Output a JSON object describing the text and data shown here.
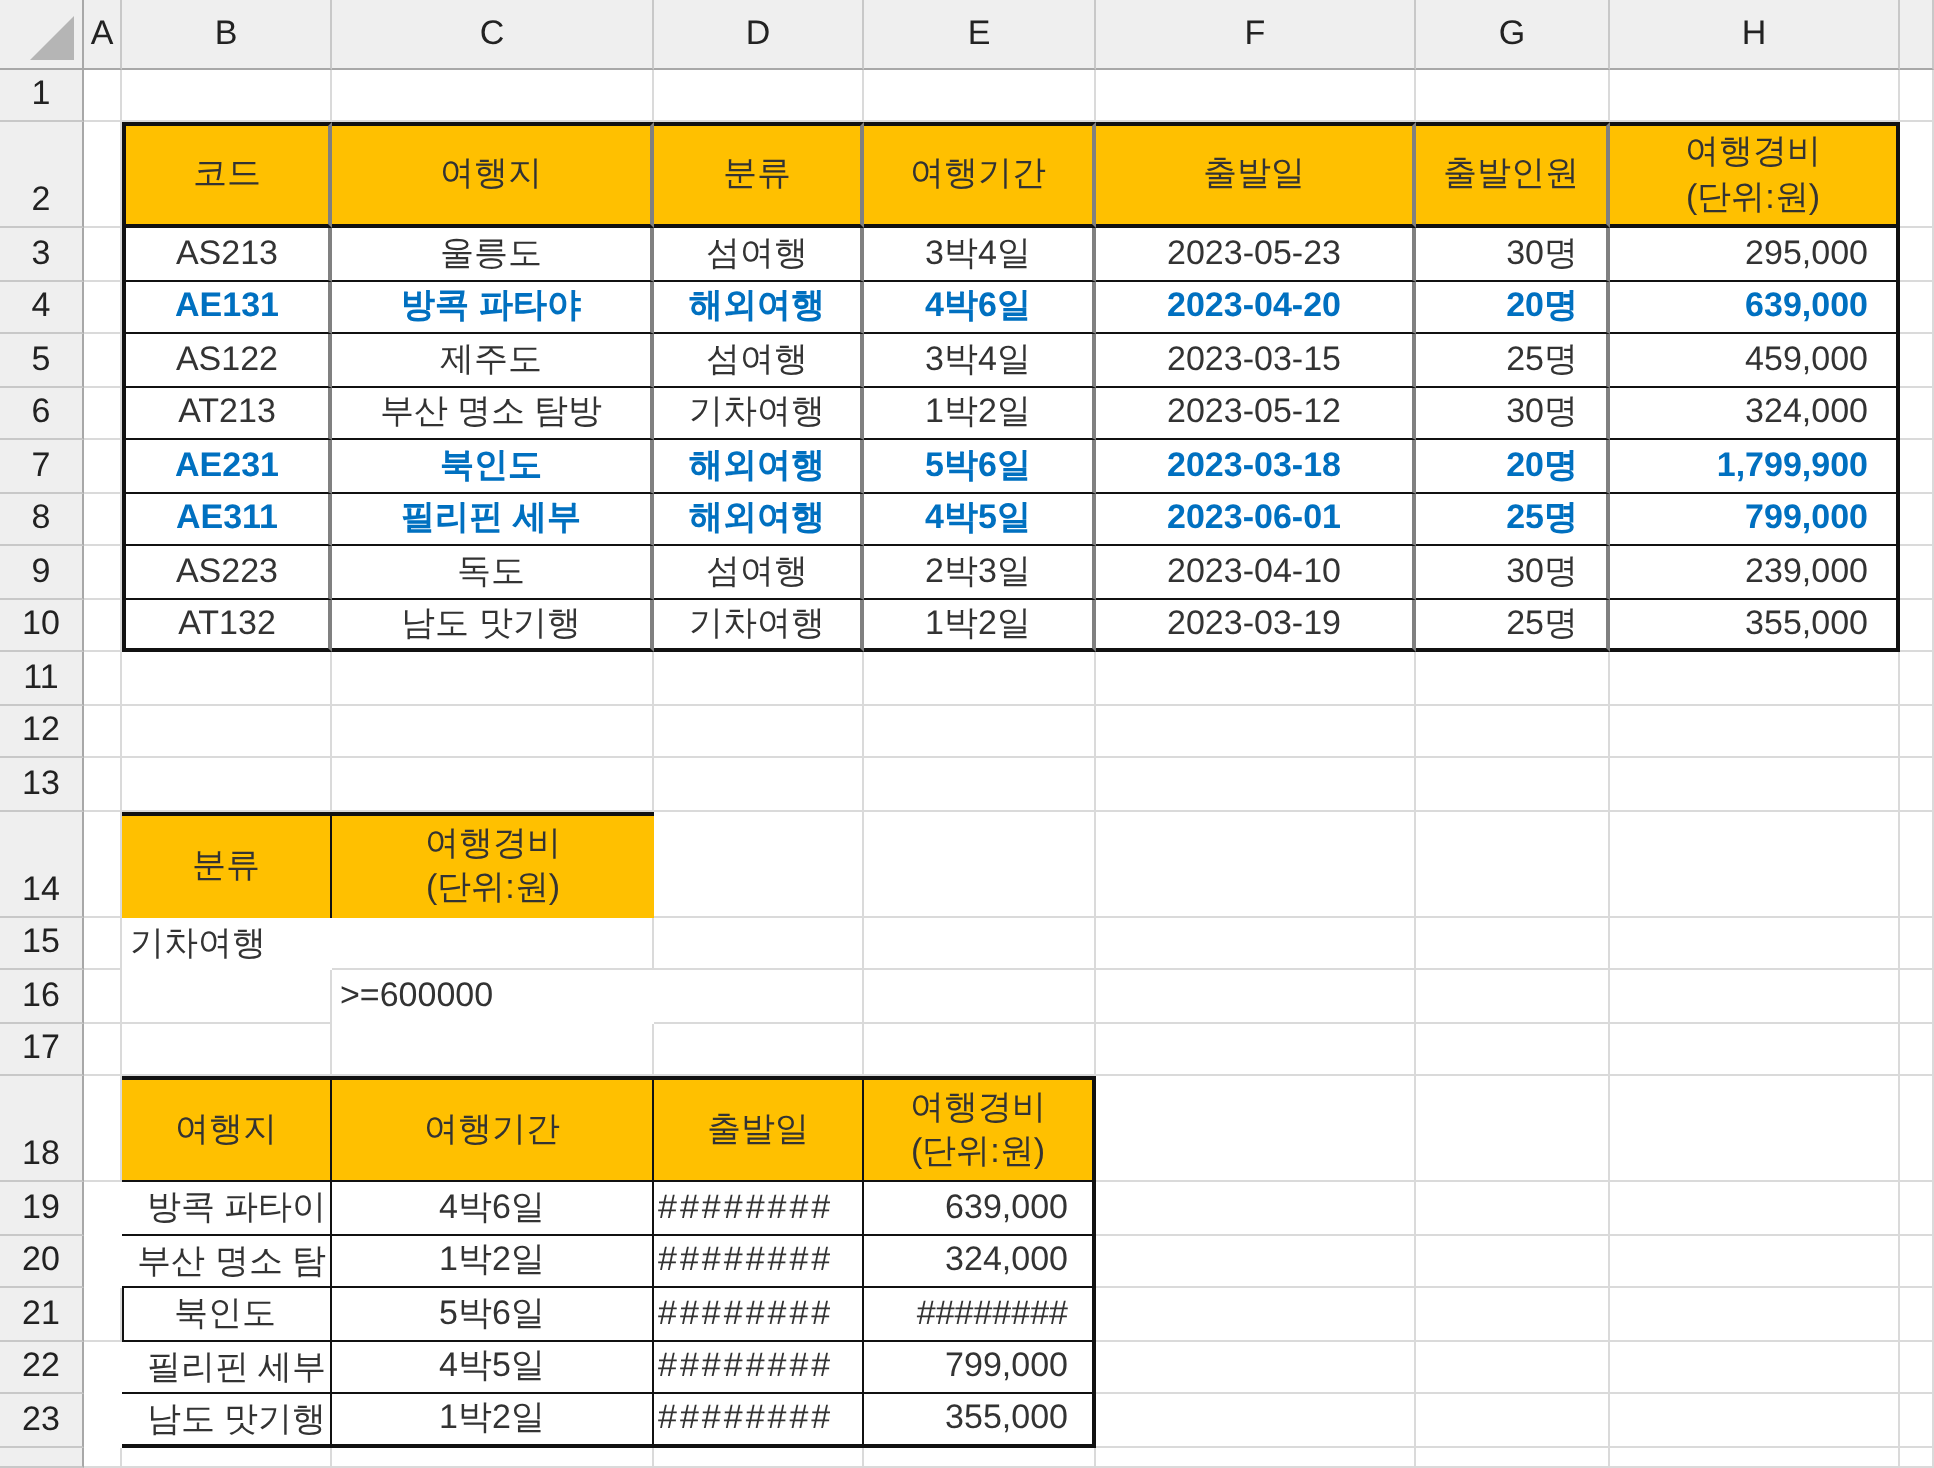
{
  "columns": [
    "A",
    "B",
    "C",
    "D",
    "E",
    "F",
    "G",
    "H"
  ],
  "rows": [
    "1",
    "2",
    "3",
    "4",
    "5",
    "6",
    "7",
    "8",
    "9",
    "10",
    "11",
    "12",
    "13",
    "14",
    "15",
    "16",
    "17",
    "18",
    "19",
    "20",
    "21",
    "22",
    "23"
  ],
  "trips": {
    "headers": [
      {
        "text": "코드",
        "kind": "text"
      },
      {
        "text": "여행지",
        "kind": "text"
      },
      {
        "text": "분류",
        "kind": "text"
      },
      {
        "text": "여행기간",
        "kind": "text"
      },
      {
        "text": "출발일",
        "kind": "text"
      },
      {
        "text": "출발인원",
        "kind": "number"
      },
      {
        "text": "여행경비\n(단위:원)",
        "kind": "number"
      }
    ],
    "rows": [
      {
        "highlighted": false,
        "cells": [
          "AS213",
          "울릉도",
          "섬여행",
          "3박4일",
          "2023-05-23",
          "30명",
          "295,000"
        ]
      },
      {
        "highlighted": true,
        "cells": [
          "AE131",
          "방콕 파타야",
          "해외여행",
          "4박6일",
          "2023-04-20",
          "20명",
          "639,000"
        ]
      },
      {
        "highlighted": false,
        "cells": [
          "AS122",
          "제주도",
          "섬여행",
          "3박4일",
          "2023-03-15",
          "25명",
          "459,000"
        ]
      },
      {
        "highlighted": false,
        "cells": [
          "AT213",
          "부산 명소 탐방",
          "기차여행",
          "1박2일",
          "2023-05-12",
          "30명",
          "324,000"
        ]
      },
      {
        "highlighted": true,
        "cells": [
          "AE231",
          "북인도",
          "해외여행",
          "5박6일",
          "2023-03-18",
          "20명",
          "1,799,900"
        ]
      },
      {
        "highlighted": true,
        "cells": [
          "AE311",
          "필리핀 세부",
          "해외여행",
          "4박5일",
          "2023-06-01",
          "25명",
          "799,000"
        ]
      },
      {
        "highlighted": false,
        "cells": [
          "AS223",
          "독도",
          "섬여행",
          "2박3일",
          "2023-04-10",
          "30명",
          "239,000"
        ]
      },
      {
        "highlighted": false,
        "cells": [
          "AT132",
          "남도 맛기행",
          "기차여행",
          "1박2일",
          "2023-03-19",
          "25명",
          "355,000"
        ]
      }
    ]
  },
  "criteria": {
    "headers": [
      "분류",
      "여행경비\n(단위:원)"
    ],
    "rows": [
      {
        "kind": "category",
        "text": "기차여행"
      },
      {
        "kind": "cost",
        "text": ">=600000"
      }
    ]
  },
  "result": {
    "headers": [
      {
        "text": "여행지",
        "kind": "place"
      },
      {
        "text": "여행기간",
        "kind": "text"
      },
      {
        "text": "출발일",
        "kind": "hash"
      },
      {
        "text": "여행경비\n(단위:원)",
        "kind": "number"
      }
    ],
    "rows": [
      {
        "boxed": false,
        "cells": [
          "방콕 파타이",
          "4박6일",
          "########",
          "639,000"
        ]
      },
      {
        "boxed": false,
        "cells": [
          "부산 명소 탐",
          "1박2일",
          "########",
          "324,000"
        ]
      },
      {
        "boxed": true,
        "cells": [
          "북인도",
          "5박6일",
          "########",
          "########"
        ]
      },
      {
        "boxed": false,
        "cells": [
          "필리핀 세부",
          "4박5일",
          "########",
          "799,000"
        ]
      },
      {
        "boxed": false,
        "cells": [
          "남도 맛기행",
          "1박2일",
          "########",
          "355,000"
        ]
      }
    ]
  }
}
